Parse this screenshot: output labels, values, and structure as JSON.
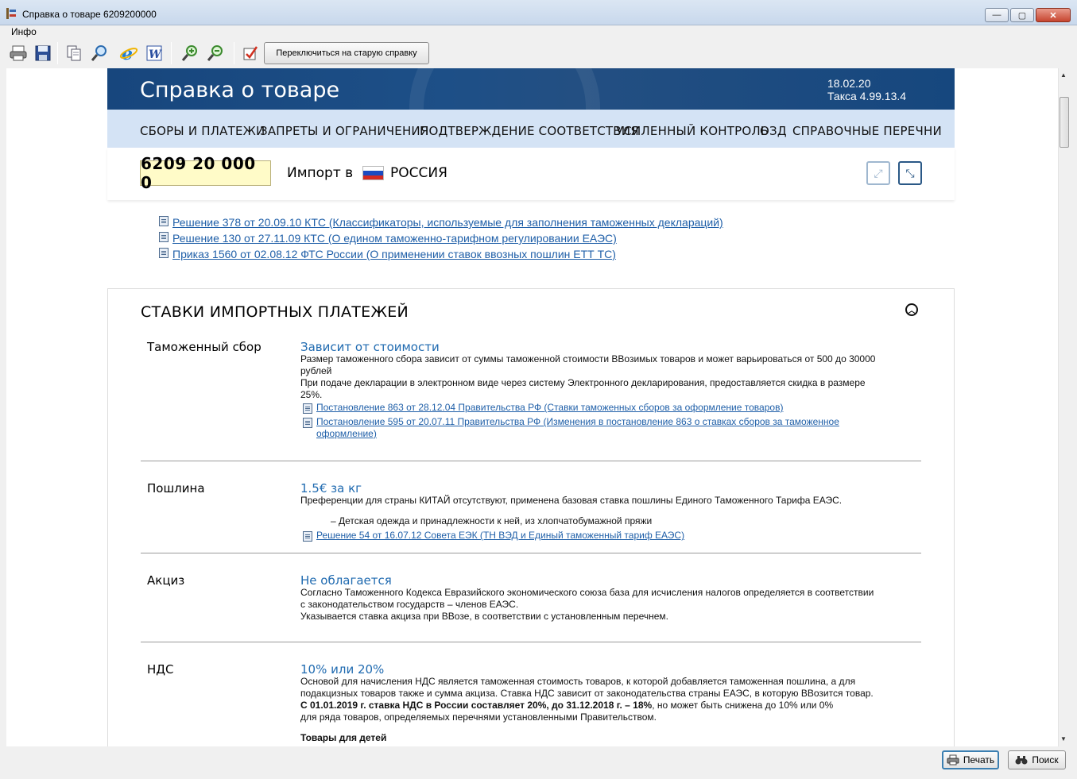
{
  "window": {
    "title": "Справка о товаре 6209200000",
    "buttons": {
      "minimize": "—",
      "maximize": "▢",
      "close": "✕"
    }
  },
  "menu": {
    "info": "Инфо"
  },
  "toolbar": {
    "switch_button": "Переключиться на старую справку",
    "icons": [
      "printer-icon",
      "save-icon",
      "copy-icon",
      "find-icon",
      "ie-icon",
      "word-icon",
      "zoom-in-icon",
      "zoom-out-icon",
      "checkbox-icon"
    ]
  },
  "header": {
    "title": "Справка о товаре",
    "date": "18.02.20",
    "tax_version": "Такса 4.99.13.4"
  },
  "nav": {
    "items": [
      "СБОРЫ И ПЛАТЕЖИ",
      "ЗАПРЕТЫ И ОГРАНИЧЕНИЯ",
      "ПОДТВЕРЖДЕНИЕ СООТВЕТСТВИЯ",
      "УСИЛЕННЫЙ КОНТРОЛЬ",
      "ОЗД",
      "СПРАВОЧНЫЕ ПЕРЕЧНИ"
    ]
  },
  "code": {
    "value": "6209 20 000 0",
    "direction": "Импорт в",
    "country": "РОССИЯ"
  },
  "top_links": [
    "Решение 378 от 20.09.10 КТС (Классификаторы, используемые для заполнения таможенных деклараций)",
    "Решение 130 от 27.11.09 КТС (О едином таможенно-тарифном регулировании ЕАЭС)",
    "Приказ 1560 от 02.08.12 ФТС России (О применении ставок ввозных пошлин ЕТТ ТС)"
  ],
  "rates": {
    "title": "СТАВКИ ИМПОРТНЫХ ПЛАТЕЖЕЙ",
    "customs_fee": {
      "label": "Таможенный сбор",
      "value": "Зависит от стоимости",
      "text1": "Размер таможенного сбора зависит от суммы таможенной стоимости ВВозимых товаров и может варьироваться от 500 до 30000",
      "text1b": "рублей",
      "text2": "При подаче декларации в электронном виде через систему Электронного декларирования, предоставляется скидка в размере",
      "text2b": "25%.",
      "link1": "Постановление 863 от 28.12.04 Правительства РФ (Ставки таможенных сборов за оформление товаров)",
      "link2a": "Постановление 595 от 20.07.11 Правительства РФ (Изменения в постановление 863 о ставках сборов за таможенное",
      "link2b": "оформление)"
    },
    "duty": {
      "label": "Пошлина",
      "value": "1.5€ за кг",
      "text1": "Преференции для страны КИТАЙ отсутствуют, применена базовая ставка пошлины Единого Таможенного Тарифа ЕАЭС.",
      "item": "– Детская одежда и принадлежности к ней, из хлопчатобумажной пряжи",
      "link": "Решение 54 от 16.07.12 Совета ЕЭК (ТН ВЭД и Единый таможенный тариф ЕАЭС)"
    },
    "excise": {
      "label": "Акциз",
      "value": "Не облагается",
      "text1": "Согласно Таможенного Кодекса Евразийского экономического союза база для исчисления налогов определяется в соответствии",
      "text1b": "с законодательством государств – членов ЕАЭС.",
      "text2": "Указывается ставка акциза при ВВозе, в соответствии с установленным перечнем."
    },
    "vat": {
      "label": "НДС",
      "value": "10% или 20%",
      "text1": "Основой для начисления НДС является таможенная стоимость товаров, к которой добавляется таможенная пошлина, а для",
      "text1b": "подакцизных товаров также и сумма акциза. Ставка НДС зависит от законодательства страны ЕАЭС, в которую ВВозится товар.",
      "bold": "С 01.01.2019 г. ставка НДС в России составляет 20%, до 31.12.2018 г. – 18%",
      "text2": ", но может быть снижена до 10% или 0%",
      "text2b": "для ряда товаров, определяемых перечнями установленными Правительством.",
      "subheading": "Товары для детей"
    }
  },
  "bottom": {
    "print": "Печать",
    "search": "Поиск"
  }
}
